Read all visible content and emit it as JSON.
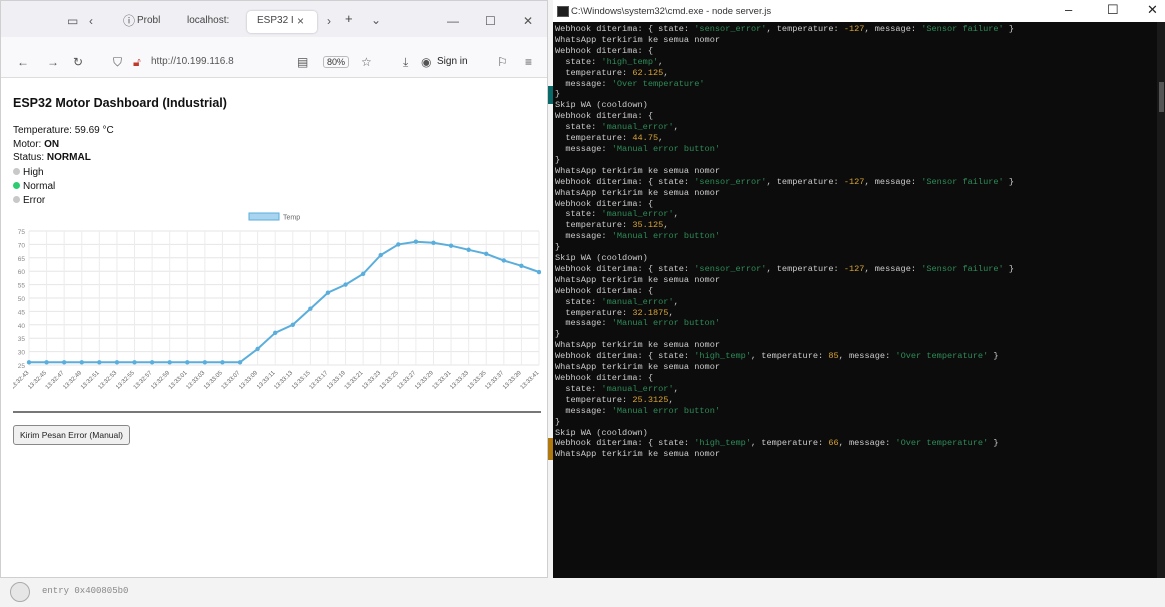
{
  "browser": {
    "tabs": [
      "Probl",
      "localhost:",
      "ESP32 I",
      "+"
    ],
    "url": "http://10.199.116.8",
    "zoom": "80%",
    "signin": "Sign in"
  },
  "dashboard": {
    "title": "ESP32 Motor Dashboard (Industrial)",
    "temperature_label": "Temperature:",
    "temperature_value": "59.69 °C",
    "motor_label": "Motor:",
    "motor_value": "ON",
    "status_label": "Status:",
    "status_value": "NORMAL",
    "indicators": [
      {
        "label": "High",
        "color": "#c8c8c8"
      },
      {
        "label": "Normal",
        "color": "#2ecc71"
      },
      {
        "label": "Error",
        "color": "#c8c8c8"
      }
    ],
    "button_label": "Kirim Pesan Error (Manual)"
  },
  "chart_data": {
    "type": "line",
    "legend": "Temp",
    "legend_position": "top-center",
    "color": "#5aaedc",
    "ylim": [
      25,
      75
    ],
    "yticks": [
      25,
      30,
      35,
      40,
      45,
      50,
      55,
      60,
      65,
      70,
      75
    ],
    "grid": true,
    "x": [
      "13:32:43",
      "13:32:45",
      "13:32:47",
      "13:32:49",
      "13:32:51",
      "13:32:53",
      "13:32:55",
      "13:32:57",
      "13:32:59",
      "13:33:01",
      "13:33:03",
      "13:33:05",
      "13:33:07",
      "13:33:09",
      "13:33:11",
      "13:33:13",
      "13:33:15",
      "13:33:17",
      "13:33:19",
      "13:33:21",
      "13:33:23",
      "13:33:25",
      "13:33:27",
      "13:33:29",
      "13:33:31",
      "13:33:33",
      "13:33:35",
      "13:33:37",
      "13:33:39",
      "13:33:41"
    ],
    "values": [
      26,
      26,
      26,
      26,
      26,
      26,
      26,
      26,
      26,
      26,
      26,
      26,
      26,
      31,
      37,
      40,
      46,
      52,
      55,
      59,
      66,
      70,
      71,
      70.6,
      69.5,
      68,
      66.5,
      64,
      62,
      59.69
    ]
  },
  "terminal": {
    "title": "C:\\Windows\\system32\\cmd.exe - node server.js",
    "lines": [
      [
        [
          "Webhook diterima: { state: ",
          ""
        ],
        [
          "'sensor_error'",
          "s"
        ],
        [
          ", temperature: ",
          ""
        ],
        [
          "-127",
          "n"
        ],
        [
          ", message: ",
          ""
        ],
        [
          "'Sensor failure'",
          "s"
        ],
        [
          " }",
          ""
        ]
      ],
      [
        [
          "WhatsApp terkirim ke semua nomor",
          ""
        ]
      ],
      [
        [
          "Webhook diterima: {",
          ""
        ]
      ],
      [
        [
          "  state: ",
          ""
        ],
        [
          "'high_temp'",
          "s"
        ],
        [
          ",",
          ""
        ]
      ],
      [
        [
          "  temperature: ",
          ""
        ],
        [
          "62.125",
          "n"
        ],
        [
          ",",
          ""
        ]
      ],
      [
        [
          "  message: ",
          ""
        ],
        [
          "'Over temperature'",
          "s"
        ]
      ],
      [
        [
          "}",
          ""
        ]
      ],
      [
        [
          "Skip WA (cooldown)",
          ""
        ]
      ],
      [
        [
          "Webhook diterima: {",
          ""
        ]
      ],
      [
        [
          "  state: ",
          ""
        ],
        [
          "'manual_error'",
          "s"
        ],
        [
          ",",
          ""
        ]
      ],
      [
        [
          "  temperature: ",
          ""
        ],
        [
          "44.75",
          "n"
        ],
        [
          ",",
          ""
        ]
      ],
      [
        [
          "  message: ",
          ""
        ],
        [
          "'Manual error button'",
          "s"
        ]
      ],
      [
        [
          "}",
          ""
        ]
      ],
      [
        [
          "WhatsApp terkirim ke semua nomor",
          ""
        ]
      ],
      [
        [
          "Webhook diterima: { state: ",
          ""
        ],
        [
          "'sensor_error'",
          "s"
        ],
        [
          ", temperature: ",
          ""
        ],
        [
          "-127",
          "n"
        ],
        [
          ", message: ",
          ""
        ],
        [
          "'Sensor failure'",
          "s"
        ],
        [
          " }",
          ""
        ]
      ],
      [
        [
          "WhatsApp terkirim ke semua nomor",
          ""
        ]
      ],
      [
        [
          "Webhook diterima: {",
          ""
        ]
      ],
      [
        [
          "  state: ",
          ""
        ],
        [
          "'manual_error'",
          "s"
        ],
        [
          ",",
          ""
        ]
      ],
      [
        [
          "  temperature: ",
          ""
        ],
        [
          "35.125",
          "n"
        ],
        [
          ",",
          ""
        ]
      ],
      [
        [
          "  message: ",
          ""
        ],
        [
          "'Manual error button'",
          "s"
        ]
      ],
      [
        [
          "}",
          ""
        ]
      ],
      [
        [
          "Skip WA (cooldown)",
          ""
        ]
      ],
      [
        [
          "Webhook diterima: { state: ",
          ""
        ],
        [
          "'sensor_error'",
          "s"
        ],
        [
          ", temperature: ",
          ""
        ],
        [
          "-127",
          "n"
        ],
        [
          ", message: ",
          ""
        ],
        [
          "'Sensor failure'",
          "s"
        ],
        [
          " }",
          ""
        ]
      ],
      [
        [
          "WhatsApp terkirim ke semua nomor",
          ""
        ]
      ],
      [
        [
          "Webhook diterima: {",
          ""
        ]
      ],
      [
        [
          "  state: ",
          ""
        ],
        [
          "'manual_error'",
          "s"
        ],
        [
          ",",
          ""
        ]
      ],
      [
        [
          "  temperature: ",
          ""
        ],
        [
          "32.1875",
          "n"
        ],
        [
          ",",
          ""
        ]
      ],
      [
        [
          "  message: ",
          ""
        ],
        [
          "'Manual error button'",
          "s"
        ]
      ],
      [
        [
          "}",
          ""
        ]
      ],
      [
        [
          "WhatsApp terkirim ke semua nomor",
          ""
        ]
      ],
      [
        [
          "Webhook diterima: { state: ",
          ""
        ],
        [
          "'high_temp'",
          "s"
        ],
        [
          ", temperature: ",
          ""
        ],
        [
          "85",
          "n"
        ],
        [
          ", message: ",
          ""
        ],
        [
          "'Over temperature'",
          "s"
        ],
        [
          " }",
          ""
        ]
      ],
      [
        [
          "WhatsApp terkirim ke semua nomor",
          ""
        ]
      ],
      [
        [
          "Webhook diterima: {",
          ""
        ]
      ],
      [
        [
          "  state: ",
          ""
        ],
        [
          "'manual_error'",
          "s"
        ],
        [
          ",",
          ""
        ]
      ],
      [
        [
          "  temperature: ",
          ""
        ],
        [
          "25.3125",
          "n"
        ],
        [
          ",",
          ""
        ]
      ],
      [
        [
          "  message: ",
          ""
        ],
        [
          "'Manual error button'",
          "s"
        ]
      ],
      [
        [
          "}",
          ""
        ]
      ],
      [
        [
          "Skip WA (cooldown)",
          ""
        ]
      ],
      [
        [
          "Webhook diterima: { state: ",
          ""
        ],
        [
          "'high_temp'",
          "s"
        ],
        [
          ", temperature: ",
          ""
        ],
        [
          "66",
          "n"
        ],
        [
          ", message: ",
          ""
        ],
        [
          "'Over temperature'",
          "s"
        ],
        [
          " }",
          ""
        ]
      ],
      [
        [
          "WhatsApp terkirim ke semua nomor",
          ""
        ]
      ]
    ]
  },
  "footer": {
    "entry_text": "entry 0x400805b0"
  }
}
